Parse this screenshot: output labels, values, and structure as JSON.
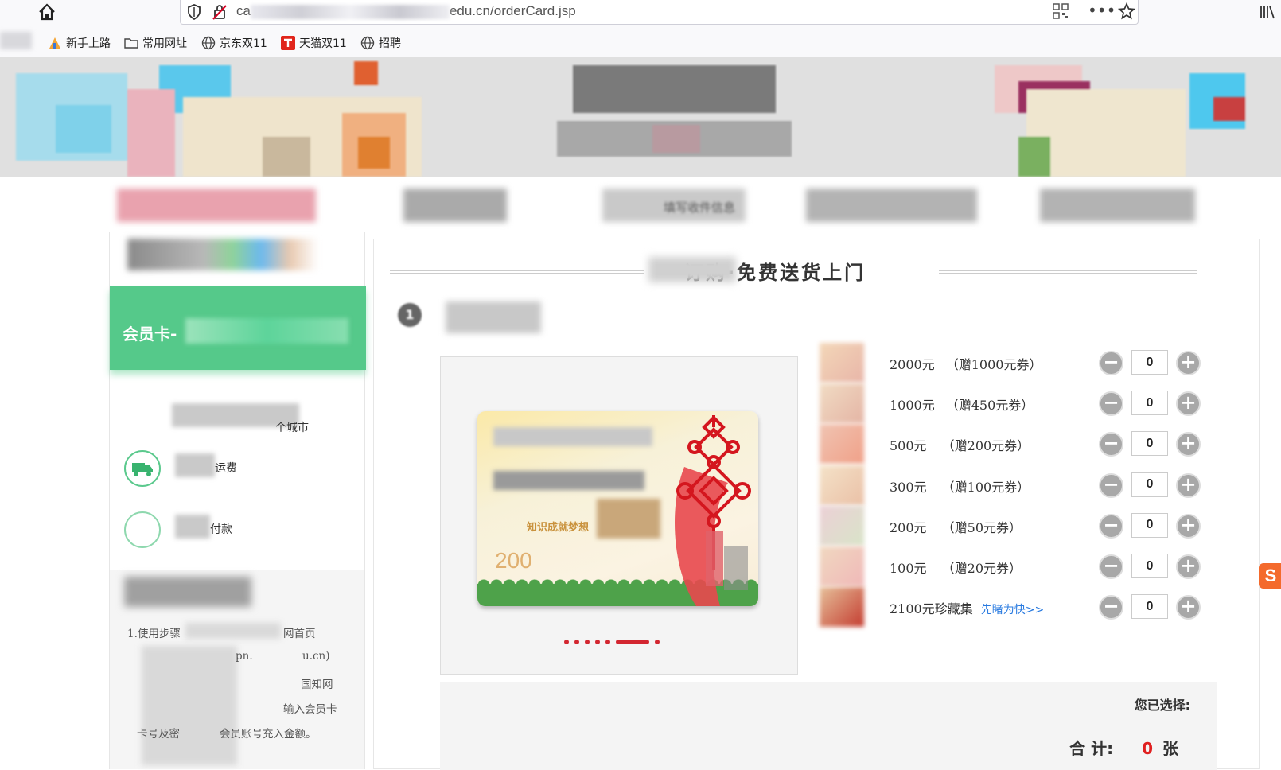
{
  "browser": {
    "url_visible_prefix": "ca",
    "url_visible_suffix": "edu.cn/orderCard.jsp",
    "bookmarks": [
      {
        "label": "新手上路",
        "icon": "new-user-icon"
      },
      {
        "label": "常用网址",
        "icon": "folder-icon"
      },
      {
        "label": "京东双11",
        "icon": "globe-icon"
      },
      {
        "label": "天猫双11",
        "icon": "tmall-icon"
      },
      {
        "label": "招聘",
        "icon": "globe-icon"
      }
    ]
  },
  "steps": {
    "step3_label": "填写收件信息"
  },
  "left": {
    "member_card_label": "会员卡-",
    "features": [
      {
        "text": "个城市",
        "icon": "location-icon"
      },
      {
        "text": "运费",
        "icon": "truck-icon"
      },
      {
        "text": "付款",
        "icon": "payment-icon"
      }
    ],
    "howto_lines": [
      "1.使用步骤",
      "网首页",
      "pn.",
      "u.cn)",
      "国知网",
      "输入会员卡",
      "卡号及密",
      "会员账号充入金额。"
    ]
  },
  "main": {
    "slogan": "订购·免费送货上门",
    "step_number": "1",
    "card_amount": "200",
    "card_motto": "知识成就梦想",
    "carousel": {
      "count": 6,
      "active_index": 5
    },
    "products": [
      {
        "price": "2000元",
        "gift": "（赠1000元券）",
        "qty": "0"
      },
      {
        "price": "1000元",
        "gift": "（赠450元券）",
        "qty": "0"
      },
      {
        "price": "500元 ",
        "gift": "（赠200元券）",
        "qty": "0"
      },
      {
        "price": "300元 ",
        "gift": "（赠100元券）",
        "qty": "0"
      },
      {
        "price": "200元 ",
        "gift": "（赠50元券）",
        "qty": "0"
      },
      {
        "price": "100元 ",
        "gift": "（赠20元券）",
        "qty": "0"
      },
      {
        "price": "2100元珍藏集",
        "gift": "",
        "link": "先睹为快>>",
        "qty": "0"
      }
    ],
    "summary": {
      "selected_label": "您已选择:",
      "total_label": "合 计:",
      "total_count": "0",
      "unit": "张"
    }
  },
  "side_badge": "S",
  "colors": {
    "accent_green": "#55c98a",
    "accent_red": "#d32630",
    "link_blue": "#2a7be0"
  }
}
